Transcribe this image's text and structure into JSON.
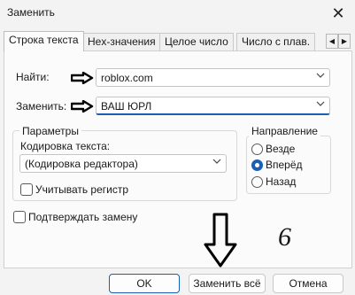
{
  "window": {
    "title": "Заменить",
    "close_icon": "close-icon"
  },
  "tabs": [
    {
      "label": "Строка текста",
      "active": true
    },
    {
      "label": "Hex-значения",
      "active": false
    },
    {
      "label": "Целое число",
      "active": false
    },
    {
      "label": "Число с плав.",
      "active": false
    }
  ],
  "find": {
    "label": "Найти:",
    "value": "roblox.com"
  },
  "replace": {
    "label": "Заменить:",
    "value": "ВАШ ЮРЛ"
  },
  "options": {
    "title": "Параметры",
    "encoding_label": "Кодировка текста:",
    "encoding_value": "(Кодировка редактора)",
    "match_case": "Учитывать регистр"
  },
  "direction": {
    "title": "Направление",
    "items": [
      {
        "label": "Везде",
        "checked": false
      },
      {
        "label": "Вперёд",
        "checked": true
      },
      {
        "label": "Назад",
        "checked": false
      }
    ]
  },
  "confirm": "Подтверждать замену",
  "buttons": {
    "ok": "OK",
    "replace_all": "Заменить всё",
    "cancel": "Отмена"
  },
  "annotation": {
    "step": "6"
  },
  "colors": {
    "accent": "#1a5fb4",
    "background": "#f3f3f3"
  }
}
